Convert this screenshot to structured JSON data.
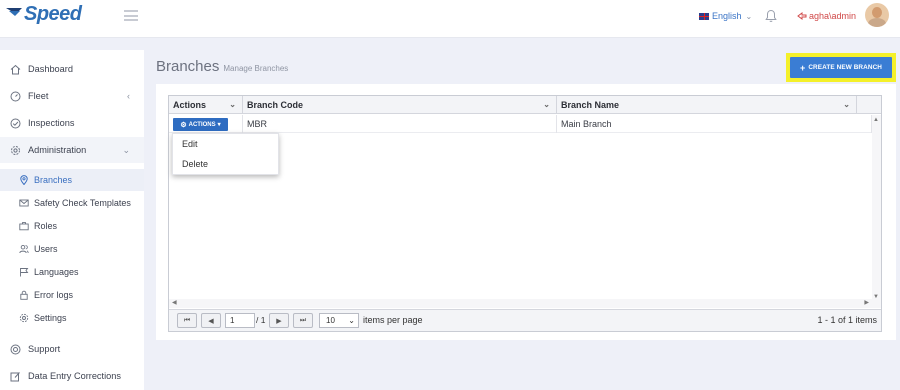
{
  "app": {
    "logo_text": "Speed"
  },
  "header": {
    "language": "English",
    "user": "agha\\admin"
  },
  "sidebar": {
    "items": [
      {
        "label": "Dashboard",
        "icon": "home-icon"
      },
      {
        "label": "Fleet",
        "icon": "gauge-icon"
      },
      {
        "label": "Inspections",
        "icon": "check-circle-icon"
      },
      {
        "label": "Administration",
        "icon": "gear-icon"
      },
      {
        "label": "Support",
        "icon": "lifebuoy-icon"
      },
      {
        "label": "Data Entry Corrections",
        "icon": "edit-icon"
      }
    ],
    "subitems": [
      {
        "label": "Branches",
        "icon": "map-pin-icon",
        "active": true
      },
      {
        "label": "Safety Check Templates",
        "icon": "envelope-icon"
      },
      {
        "label": "Roles",
        "icon": "briefcase-icon"
      },
      {
        "label": "Users",
        "icon": "users-icon"
      },
      {
        "label": "Languages",
        "icon": "flag-icon"
      },
      {
        "label": "Error logs",
        "icon": "lock-icon"
      },
      {
        "label": "Settings",
        "icon": "gear-icon"
      }
    ]
  },
  "page": {
    "title": "Branches",
    "subtitle": "Manage Branches",
    "create_label": "CREATE NEW BRANCH"
  },
  "grid": {
    "columns": [
      "Actions",
      "Branch Code",
      "Branch Name"
    ],
    "rows": [
      {
        "action_label": "ACTIONS",
        "code": "MBR",
        "name": "Main Branch"
      }
    ],
    "menu": [
      "Edit",
      "Delete"
    ]
  },
  "pager": {
    "page": "1",
    "total_pages": "1",
    "page_size": "10",
    "items_label": "items per page",
    "info": "1 - 1 of 1 items"
  },
  "colors": {
    "accent": "#3a7dd4",
    "highlight": "#f4f02a",
    "user": "#d04848"
  }
}
